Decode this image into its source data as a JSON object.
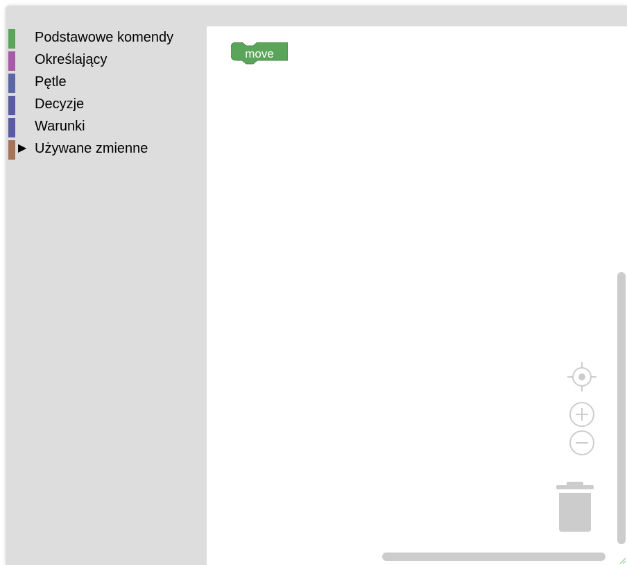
{
  "toolbox": {
    "categories": [
      {
        "label": "Podstawowe komendy",
        "color": "#5ba55b",
        "expandable": false
      },
      {
        "label": "Określający",
        "color": "#a55ba5",
        "expandable": false
      },
      {
        "label": "Pętle",
        "color": "#5b67a5",
        "expandable": false
      },
      {
        "label": "Decyzje",
        "color": "#5b5ba5",
        "expandable": false
      },
      {
        "label": "Warunki",
        "color": "#5b5ba5",
        "expandable": false
      },
      {
        "label": "Używane zmienne",
        "color": "#a5745b",
        "expandable": true,
        "arrow": "▶"
      }
    ]
  },
  "workspace": {
    "blocks": [
      {
        "label": "move",
        "color": "#5ba55b"
      }
    ],
    "controls": [
      "recenter-icon",
      "zoom-in-icon",
      "zoom-out-icon",
      "trash-icon"
    ]
  }
}
